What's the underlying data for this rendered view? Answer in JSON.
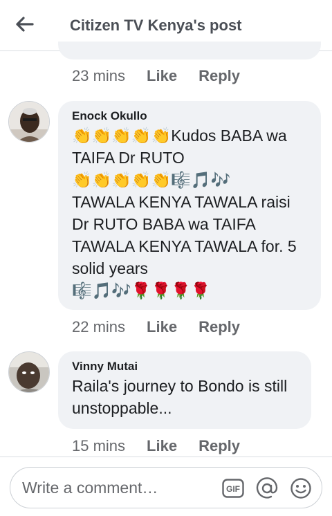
{
  "header": {
    "title": "Citizen TV Kenya's post",
    "back_icon": "arrow-left-icon"
  },
  "comments": [
    {
      "author": "",
      "text": "",
      "time": "23 mins",
      "like_label": "Like",
      "reply_label": "Reply"
    },
    {
      "author": "Enock Okullo",
      "text": "👏👏👏👏👏Kudos BABA wa TAIFA Dr RUTO\n👏👏👏👏👏🎼🎵🎶\nTAWALA KENYA TAWALA raisi Dr RUTO BABA wa TAIFA TAWALA KENYA TAWALA for. 5 solid years\n🎼🎵🎶🌹🌹🌹🌹",
      "time": "22 mins",
      "like_label": "Like",
      "reply_label": "Reply"
    },
    {
      "author": "Vinny Mutai",
      "text": "Raila's journey to Bondo is still unstoppable...",
      "time": "15 mins",
      "like_label": "Like",
      "reply_label": "Reply"
    }
  ],
  "composer": {
    "placeholder": "Write a comment…",
    "gif_label": "GIF",
    "icons": [
      "gif-icon",
      "at-mention-icon",
      "emoji-smiley-icon"
    ]
  },
  "colors": {
    "bubble": "#f0f2f5",
    "meta_text": "#65676b",
    "header_text": "#4b4f56",
    "divider": "#dadde1"
  }
}
